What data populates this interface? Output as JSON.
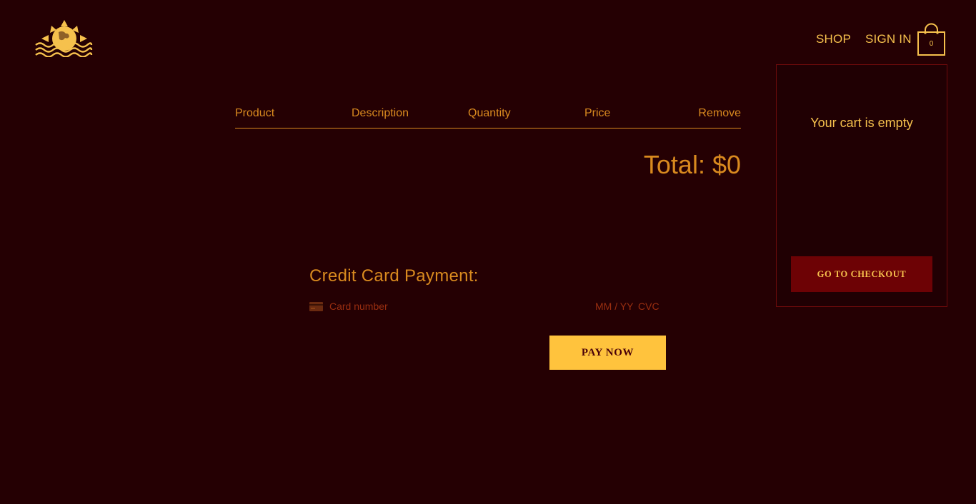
{
  "header": {
    "logo_icon": "sun-over-waves-logo",
    "nav": {
      "shop": "SHOP",
      "sign_in": "SIGN IN"
    },
    "bag_icon": "shopping-bag-icon",
    "bag_count": "0"
  },
  "cart_table": {
    "columns": [
      "Product",
      "Description",
      "Quantity",
      "Price",
      "Remove"
    ],
    "rows": [],
    "total_label": "Total: $0"
  },
  "payment": {
    "title": "Credit Card Payment:",
    "card_icon": "credit-card-icon",
    "card_number_placeholder": "Card number",
    "expiry_placeholder": "MM / YY",
    "cvc_placeholder": "CVC",
    "pay_button": "PAY NOW"
  },
  "cart_dropdown": {
    "empty_message": "Your cart is empty",
    "checkout_button": "GO TO CHECKOUT"
  },
  "colors": {
    "background": "#250003",
    "accent_gold": "#f6c14d",
    "accent_orange": "#d98a1f",
    "button_yellow": "#ffc33d",
    "button_dark_red": "#6d0205"
  }
}
